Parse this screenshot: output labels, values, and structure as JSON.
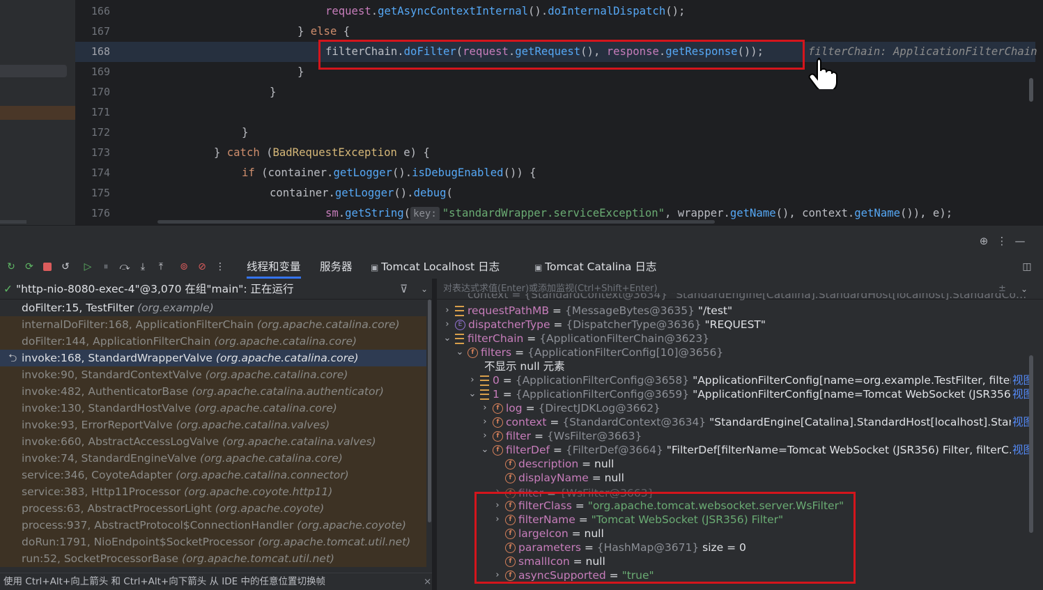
{
  "editor": {
    "line_numbers": [
      "166",
      "167",
      "168",
      "169",
      "170",
      "171",
      "172",
      "173",
      "174",
      "175",
      "176"
    ],
    "lines": [
      {
        "segs": [
          [
            "var",
            "request"
          ],
          [
            "",
            "."
          ],
          [
            "fn",
            "getAsyncContextInternal"
          ],
          [
            "",
            "()."
          ],
          [
            "fn",
            "doInternalDispatch"
          ],
          [
            "",
            "();"
          ]
        ]
      },
      {
        "segs": [
          [
            "",
            "} "
          ],
          [
            "kw",
            "else"
          ],
          [
            "",
            " {"
          ]
        ]
      },
      {
        "segs": [
          [
            "",
            "filterChain."
          ],
          [
            "fn",
            "doFilter"
          ],
          [
            "",
            "("
          ],
          [
            "var",
            "request"
          ],
          [
            "",
            "."
          ],
          [
            "fn",
            "getRequest"
          ],
          [
            "",
            "(), "
          ],
          [
            "var",
            "response"
          ],
          [
            "",
            "."
          ],
          [
            "fn",
            "getResponse"
          ],
          [
            "",
            "());"
          ]
        ]
      },
      {
        "segs": [
          [
            "",
            "}"
          ]
        ]
      },
      {
        "segs": [
          [
            "",
            "}"
          ]
        ]
      },
      {
        "segs": []
      },
      {
        "segs": [
          [
            "",
            "}"
          ]
        ]
      },
      {
        "segs": [
          [
            "",
            "} "
          ],
          [
            "kw",
            "catch"
          ],
          [
            "",
            " ("
          ],
          [
            "vr2",
            "BadRequestException"
          ],
          [
            "",
            " e) {"
          ]
        ]
      },
      {
        "segs": [
          [
            "kw",
            "if"
          ],
          [
            "",
            " (container."
          ],
          [
            "fn",
            "getLogger"
          ],
          [
            "",
            "()."
          ],
          [
            "fn",
            "isDebugEnabled"
          ],
          [
            "",
            "()) {"
          ]
        ]
      },
      {
        "segs": [
          [
            "",
            "container."
          ],
          [
            "fn",
            "getLogger"
          ],
          [
            "",
            "()."
          ],
          [
            "fn",
            "debug"
          ],
          [
            "",
            "("
          ]
        ]
      },
      {
        "segs": [
          [
            "var",
            "sm"
          ],
          [
            "",
            "."
          ],
          [
            "fn",
            "getString"
          ],
          [
            "",
            "("
          ],
          [
            "chip",
            "key:"
          ],
          [
            "str",
            "\"standardWrapper.serviceException\""
          ],
          [
            "",
            ", wrapper."
          ],
          [
            "fn",
            "getName"
          ],
          [
            "",
            "(), context."
          ],
          [
            "fn",
            "getName"
          ],
          [
            "",
            "()), e);"
          ]
        ]
      }
    ],
    "inline_hint": "filterChain: ApplicationFilterChain"
  },
  "toolbar": {
    "tabs": [
      "线程和变量",
      "服务器",
      "Tomcat Localhost 日志",
      "Tomcat Catalina 日志"
    ]
  },
  "frames": {
    "thread": "\"http-nio-8080-exec-4\"@3,070 在组\"main\": 正在运行",
    "items": [
      {
        "name": "doFilter:15, TestFilter",
        "pkg": "(org.example)",
        "kind": "first"
      },
      {
        "name": "internalDoFilter:168, ApplicationFilterChain",
        "pkg": "(org.apache.catalina.core)",
        "kind": "lib"
      },
      {
        "name": "doFilter:144, ApplicationFilterChain",
        "pkg": "(org.apache.catalina.core)",
        "kind": "lib"
      },
      {
        "name": "invoke:168, StandardWrapperValve",
        "pkg": "(org.apache.catalina.core)",
        "kind": "sel"
      },
      {
        "name": "invoke:90, StandardContextValve",
        "pkg": "(org.apache.catalina.core)",
        "kind": "lib"
      },
      {
        "name": "invoke:482, AuthenticatorBase",
        "pkg": "(org.apache.catalina.authenticator)",
        "kind": "lib"
      },
      {
        "name": "invoke:130, StandardHostValve",
        "pkg": "(org.apache.catalina.core)",
        "kind": "lib"
      },
      {
        "name": "invoke:93, ErrorReportValve",
        "pkg": "(org.apache.catalina.valves)",
        "kind": "lib"
      },
      {
        "name": "invoke:660, AbstractAccessLogValve",
        "pkg": "(org.apache.catalina.valves)",
        "kind": "lib"
      },
      {
        "name": "invoke:74, StandardEngineValve",
        "pkg": "(org.apache.catalina.core)",
        "kind": "lib"
      },
      {
        "name": "service:346, CoyoteAdapter",
        "pkg": "(org.apache.catalina.connector)",
        "kind": "lib"
      },
      {
        "name": "service:383, Http11Processor",
        "pkg": "(org.apache.coyote.http11)",
        "kind": "lib"
      },
      {
        "name": "process:63, AbstractProcessorLight",
        "pkg": "(org.apache.coyote)",
        "kind": "lib"
      },
      {
        "name": "process:937, AbstractProtocol$ConnectionHandler",
        "pkg": "(org.apache.coyote)",
        "kind": "lib"
      },
      {
        "name": "doRun:1791, NioEndpoint$SocketProcessor",
        "pkg": "(org.apache.tomcat.util.net)",
        "kind": "lib"
      },
      {
        "name": "run:52, SocketProcessorBase",
        "pkg": "(org.apache.tomcat.util.net)",
        "kind": "lib"
      }
    ],
    "status_tip": "使用 Ctrl+Alt+向上箭头 和 Ctrl+Alt+向下箭头 从 IDE 中的任意位置切换帧"
  },
  "vars": {
    "eval_placeholder": "对表达式求值(Enter)或添加监视(Ctrl+Shift+Enter)",
    "view_label": "视图",
    "rows": [
      {
        "indent": 0,
        "arrow": "›",
        "icon": "arr",
        "name": "requestPathMB",
        "type": "{MessageBytes@3635}",
        "val": "\"/test\"",
        "valclass": "vval"
      },
      {
        "indent": 0,
        "arrow": "›",
        "icon": "enum",
        "name": "dispatcherType",
        "type": "{DispatcherType@3636}",
        "val": "\"REQUEST\"",
        "valclass": "vval"
      },
      {
        "indent": 0,
        "arrow": "⌄",
        "icon": "arr",
        "name": "filterChain",
        "type": "{ApplicationFilterChain@3623}",
        "val": "",
        "valclass": "vval"
      },
      {
        "indent": 1,
        "arrow": "⌄",
        "icon": "f",
        "name": "filters",
        "type": "{ApplicationFilterConfig[10]@3656}",
        "val": "",
        "valclass": "vval"
      },
      {
        "indent": 2,
        "arrow": "",
        "icon": "",
        "name": "",
        "type": "",
        "val": "不显示 null 元素",
        "valclass": "vval",
        "plain": true
      },
      {
        "indent": 2,
        "arrow": "›",
        "icon": "arr",
        "name": "0",
        "type": "{ApplicationFilterConfig@3658}",
        "val": "\"ApplicationFilterConfig[name=org.example.TestFilter, filter…",
        "valclass": "vval",
        "view": true
      },
      {
        "indent": 2,
        "arrow": "⌄",
        "icon": "arr",
        "name": "1",
        "type": "{ApplicationFilterConfig@3659}",
        "val": "\"ApplicationFilterConfig[name=Tomcat WebSocket (JSR356…",
        "valclass": "vval",
        "view": true
      },
      {
        "indent": 3,
        "arrow": "›",
        "icon": "f",
        "name": "log",
        "type": "{DirectJDKLog@3662}",
        "val": "",
        "valclass": "vval"
      },
      {
        "indent": 3,
        "arrow": "›",
        "icon": "f",
        "name": "context",
        "type": "{StandardContext@3634}",
        "val": "\"StandardEngine[Catalina].StandardHost[localhost].Stan…",
        "valclass": "vval",
        "view": true
      },
      {
        "indent": 3,
        "arrow": "›",
        "icon": "f",
        "name": "filter",
        "type": "{WsFilter@3663}",
        "val": "",
        "valclass": "vval"
      },
      {
        "indent": 3,
        "arrow": "⌄",
        "icon": "f",
        "name": "filterDef",
        "type": "{FilterDef@3664}",
        "val": "\"FilterDef[filterName=Tomcat WebSocket (JSR356) Filter, filterC…",
        "valclass": "vval",
        "view": true
      },
      {
        "indent": 4,
        "arrow": "",
        "icon": "f",
        "name": "description",
        "type": "",
        "val": "null",
        "valclass": "vnull"
      },
      {
        "indent": 4,
        "arrow": "",
        "icon": "f",
        "name": "displayName",
        "type": "",
        "val": "null",
        "valclass": "vnull"
      },
      {
        "indent": 4,
        "arrow": "›",
        "icon": "f",
        "name": "filter",
        "type": "{WsFilter@3663}",
        "val": "",
        "valclass": "vval",
        "faded": true
      },
      {
        "indent": 4,
        "arrow": "›",
        "icon": "f",
        "name": "filterClass",
        "type": "",
        "val": "\"org.apache.tomcat.websocket.server.WsFilter\"",
        "valclass": "vstr"
      },
      {
        "indent": 4,
        "arrow": "›",
        "icon": "f",
        "name": "filterName",
        "type": "",
        "val": "\"Tomcat WebSocket (JSR356) Filter\"",
        "valclass": "vstr"
      },
      {
        "indent": 4,
        "arrow": "",
        "icon": "f",
        "name": "largeIcon",
        "type": "",
        "val": "null",
        "valclass": "vnull"
      },
      {
        "indent": 4,
        "arrow": "",
        "icon": "f",
        "name": "parameters",
        "type": "{HashMap@3671}",
        "val": " size = 0",
        "valclass": "vval"
      },
      {
        "indent": 4,
        "arrow": "",
        "icon": "f",
        "name": "smallIcon",
        "type": "",
        "val": "null",
        "valclass": "vnull"
      },
      {
        "indent": 4,
        "arrow": "›",
        "icon": "f",
        "name": "asyncSupported",
        "type": "",
        "val": "\"true\"",
        "valclass": "vstr"
      }
    ]
  },
  "colors": {
    "highlight_box": "#d4151c",
    "accent": "#3574f0"
  }
}
